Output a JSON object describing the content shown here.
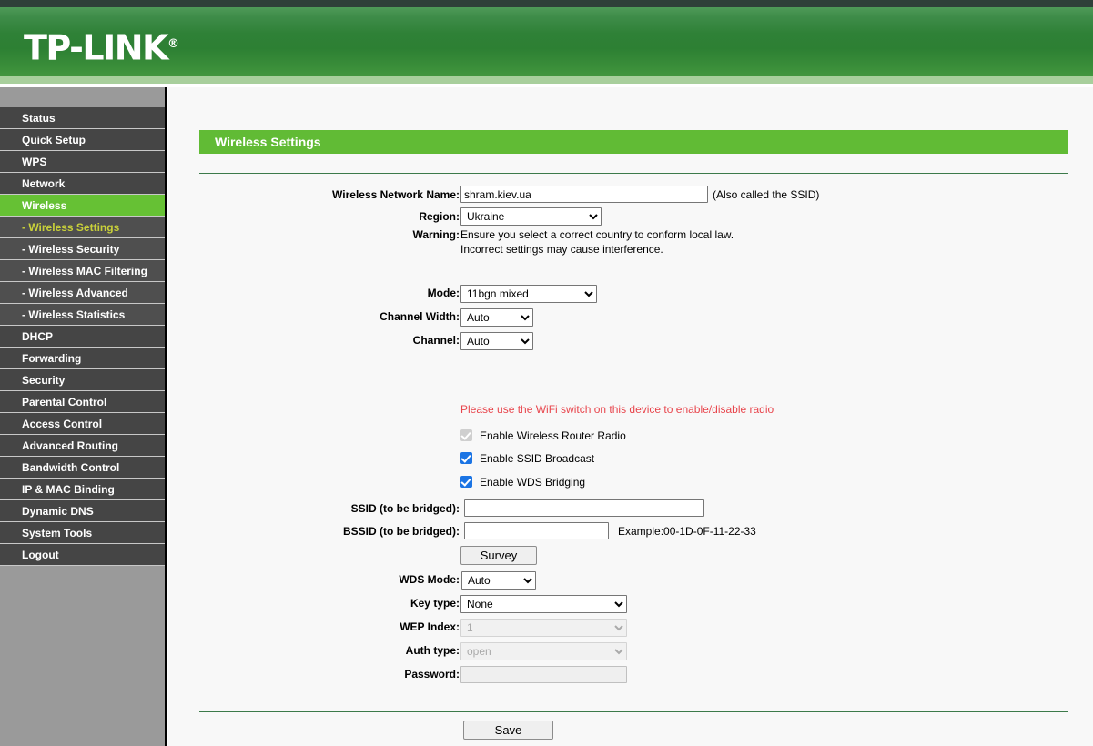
{
  "header": {
    "brand": "TP-LINK",
    "registered_mark": "®"
  },
  "sidebar": {
    "items": [
      {
        "label": "Status",
        "type": "top",
        "state": "normal"
      },
      {
        "label": "Quick Setup",
        "type": "top",
        "state": "normal"
      },
      {
        "label": "WPS",
        "type": "top",
        "state": "normal"
      },
      {
        "label": "Network",
        "type": "top",
        "state": "normal"
      },
      {
        "label": "Wireless",
        "type": "top",
        "state": "active"
      },
      {
        "label": "- Wireless Settings",
        "type": "sub",
        "state": "current"
      },
      {
        "label": "- Wireless Security",
        "type": "sub",
        "state": "normal"
      },
      {
        "label": "- Wireless MAC Filtering",
        "type": "sub",
        "state": "normal"
      },
      {
        "label": "- Wireless Advanced",
        "type": "sub",
        "state": "normal"
      },
      {
        "label": "- Wireless Statistics",
        "type": "sub",
        "state": "normal"
      },
      {
        "label": "DHCP",
        "type": "top",
        "state": "normal"
      },
      {
        "label": "Forwarding",
        "type": "top",
        "state": "normal"
      },
      {
        "label": "Security",
        "type": "top",
        "state": "normal"
      },
      {
        "label": "Parental Control",
        "type": "top",
        "state": "normal"
      },
      {
        "label": "Access Control",
        "type": "top",
        "state": "normal"
      },
      {
        "label": "Advanced Routing",
        "type": "top",
        "state": "normal"
      },
      {
        "label": "Bandwidth Control",
        "type": "top",
        "state": "normal"
      },
      {
        "label": "IP & MAC Binding",
        "type": "top",
        "state": "normal"
      },
      {
        "label": "Dynamic DNS",
        "type": "top",
        "state": "normal"
      },
      {
        "label": "System Tools",
        "type": "top",
        "state": "normal"
      },
      {
        "label": "Logout",
        "type": "top",
        "state": "normal"
      }
    ]
  },
  "page": {
    "title": "Wireless Settings"
  },
  "form": {
    "ssid": {
      "label": "Wireless Network Name:",
      "value": "shram.kiev.ua",
      "hint": "(Also called the SSID)"
    },
    "region": {
      "label": "Region:",
      "value": "Ukraine",
      "options": [
        "Ukraine"
      ]
    },
    "warning": {
      "label": "Warning:",
      "line1": "Ensure you select a correct country to conform local law.",
      "line2": "Incorrect settings may cause interference."
    },
    "mode": {
      "label": "Mode:",
      "value": "11bgn mixed",
      "options": [
        "11bgn mixed"
      ]
    },
    "channel_width": {
      "label": "Channel Width:",
      "value": "Auto",
      "options": [
        "Auto"
      ]
    },
    "channel": {
      "label": "Channel:",
      "value": "Auto",
      "options": [
        "Auto"
      ]
    },
    "radio_note": "Please use the WiFi switch on this device to enable/disable radio",
    "checkboxes": [
      {
        "label": "Enable Wireless Router Radio",
        "checked": true,
        "disabled": true
      },
      {
        "label": "Enable SSID Broadcast",
        "checked": true,
        "disabled": false
      },
      {
        "label": "Enable WDS Bridging",
        "checked": true,
        "disabled": false
      }
    ],
    "bridge_ssid": {
      "label": "SSID (to be bridged):",
      "value": ""
    },
    "bridge_bssid": {
      "label": "BSSID (to be bridged):",
      "value": "",
      "hint": "Example:00-1D-0F-11-22-33"
    },
    "survey_button": "Survey",
    "wds_mode": {
      "label": "WDS Mode:",
      "value": "Auto",
      "options": [
        "Auto"
      ]
    },
    "key_type": {
      "label": "Key type:",
      "value": "None",
      "options": [
        "None"
      ]
    },
    "wep_index": {
      "label": "WEP Index:",
      "value": "1",
      "options": [
        "1"
      ]
    },
    "auth_type": {
      "label": "Auth type:",
      "value": "open",
      "options": [
        "open"
      ]
    },
    "password": {
      "label": "Password:",
      "value": ""
    },
    "save_button": "Save"
  },
  "colors": {
    "brand_green": "#2d8033",
    "title_green": "#61bb35",
    "menu_active_green": "#66c134",
    "submenu_current_text": "#c9d13a",
    "warning_red": "#e8454c",
    "checkbox_blue": "#1b74e4"
  }
}
